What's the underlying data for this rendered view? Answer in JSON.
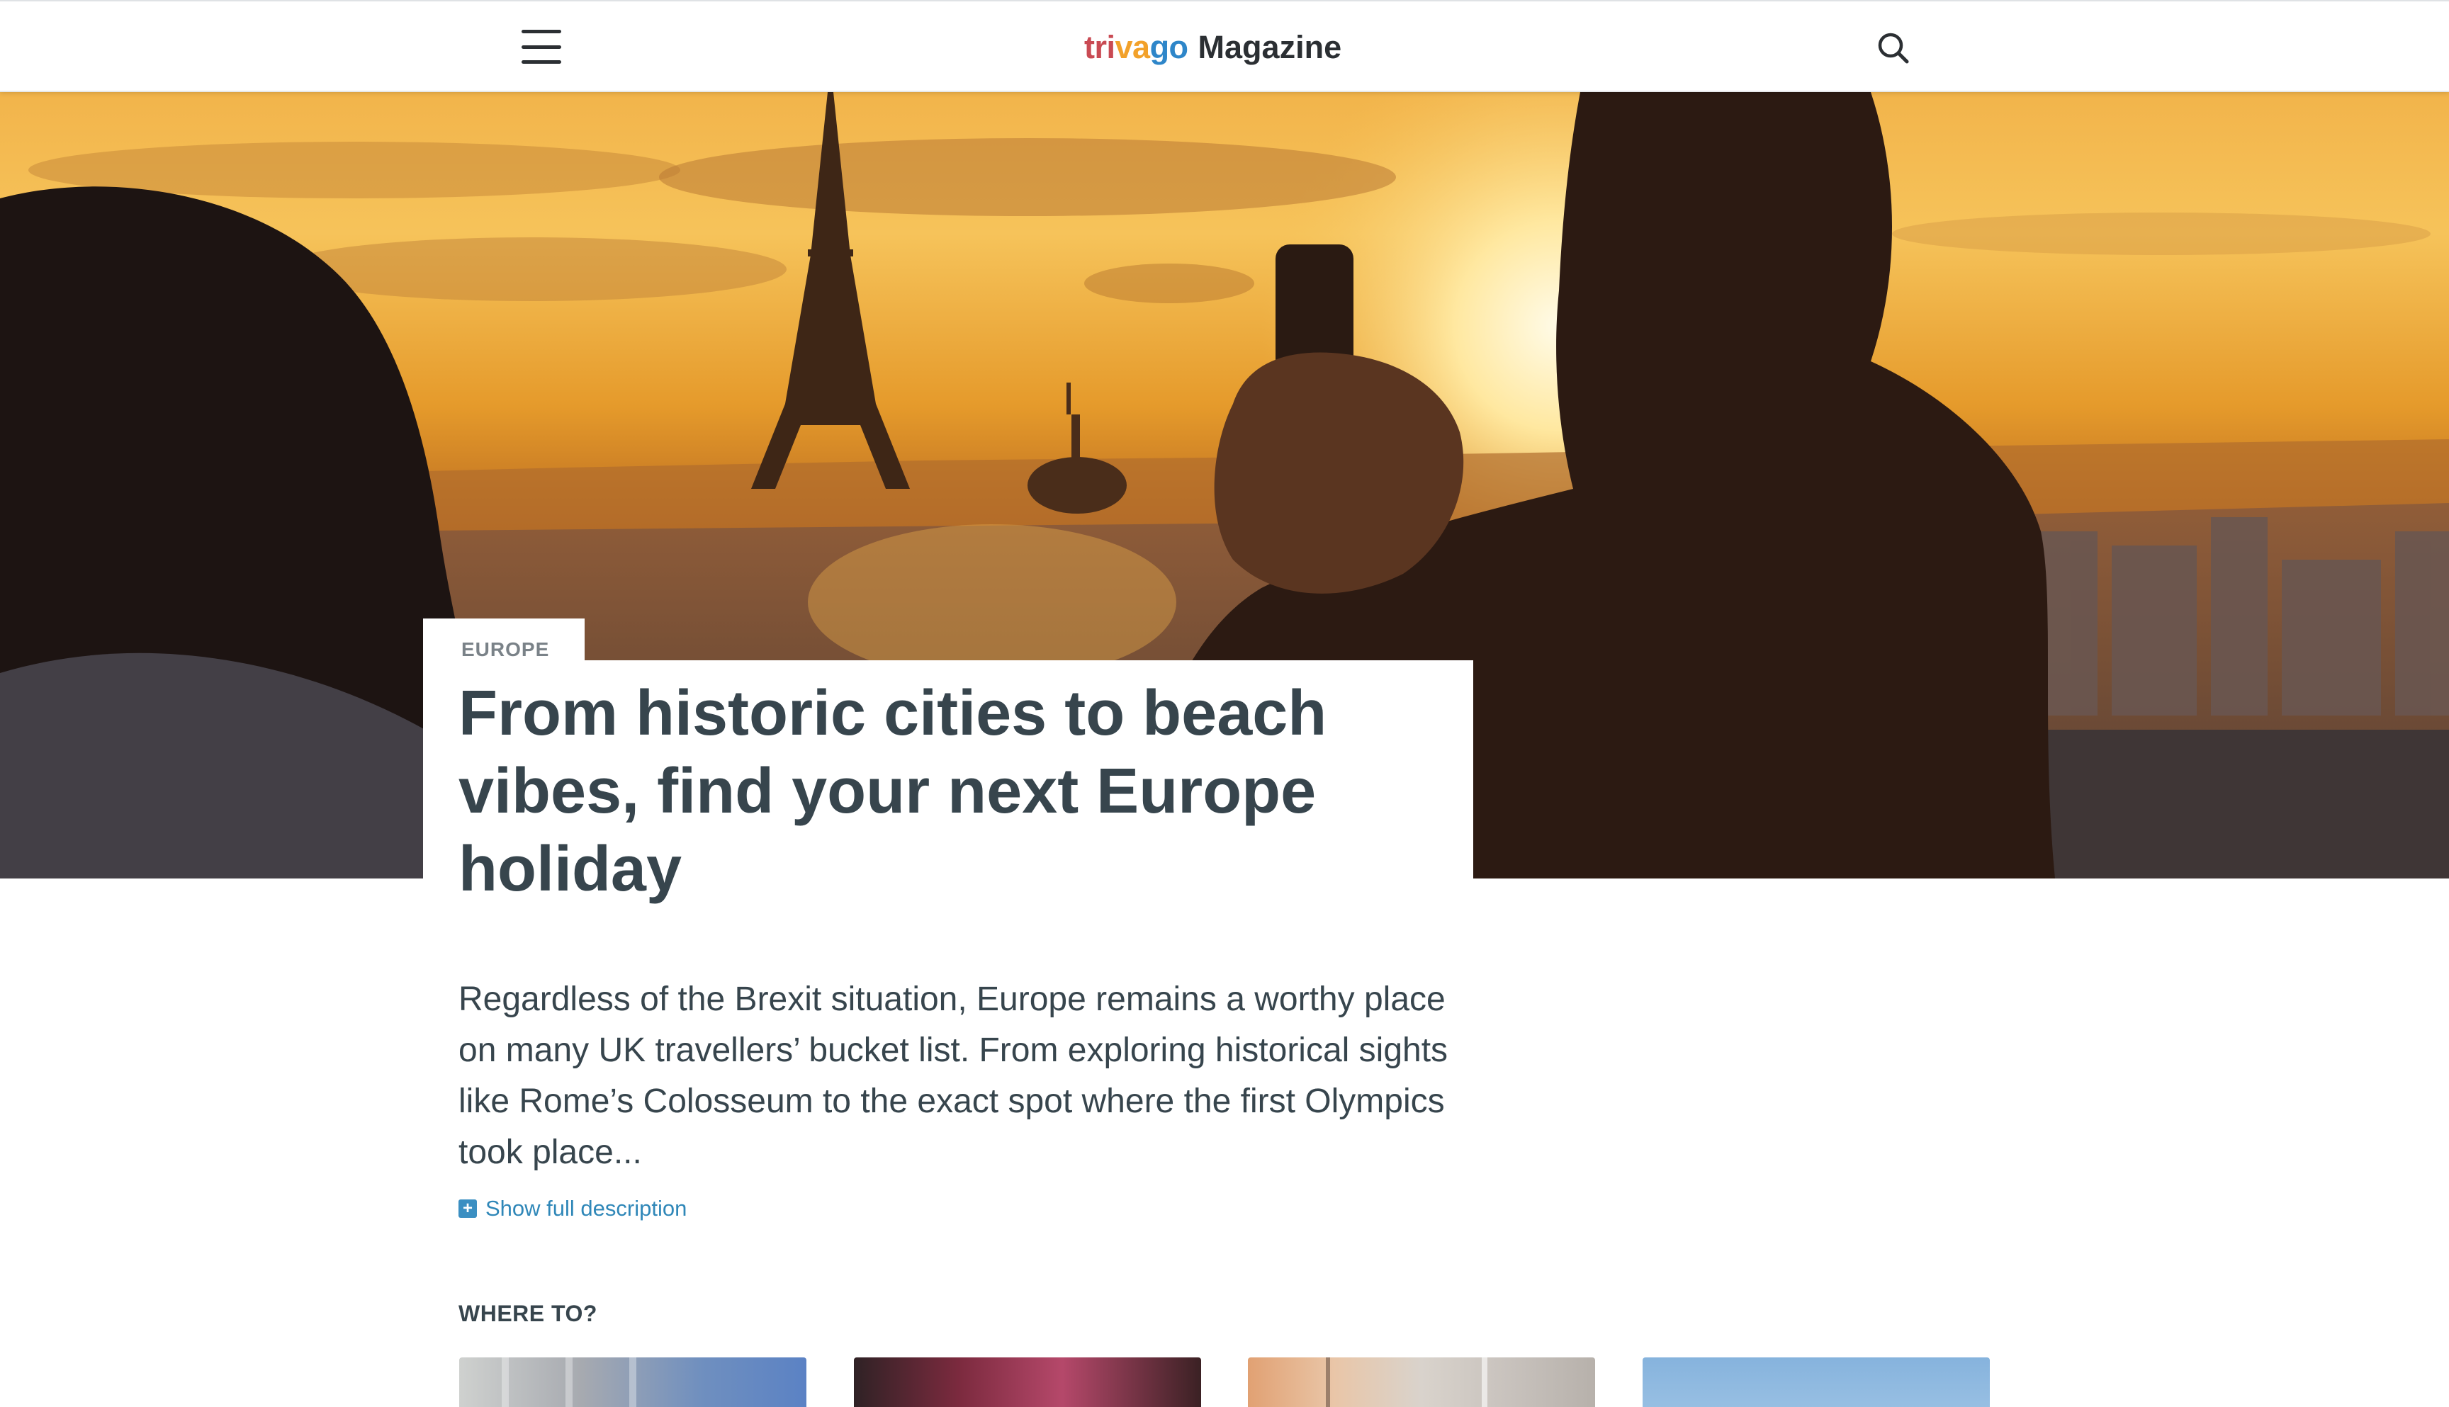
{
  "header": {
    "logo": {
      "tri": "tri",
      "va": "va",
      "go": "go",
      "magazine": "Magazine"
    },
    "menu_icon": "hamburger-menu-icon",
    "search_icon": "search-icon"
  },
  "hero": {
    "category_tag": "EUROPE",
    "title": "From historic cities to beach vibes, find your next Europe holiday"
  },
  "article": {
    "description": "Regardless of the Brexit situation, Europe remains a worthy place on many UK travellers’ bucket list. From exploring historical sights like Rome’s Colosseum to the exact spot where the first Olympics took place...",
    "show_more_label": "Show full description",
    "show_more_icon": "plus-icon"
  },
  "where_to": {
    "label": "WHERE TO?"
  },
  "colors": {
    "text": "#37454d",
    "link": "#2f87b8",
    "logo_red": "#c94a53",
    "logo_orange": "#f2a12a",
    "logo_blue": "#2e86c9"
  }
}
